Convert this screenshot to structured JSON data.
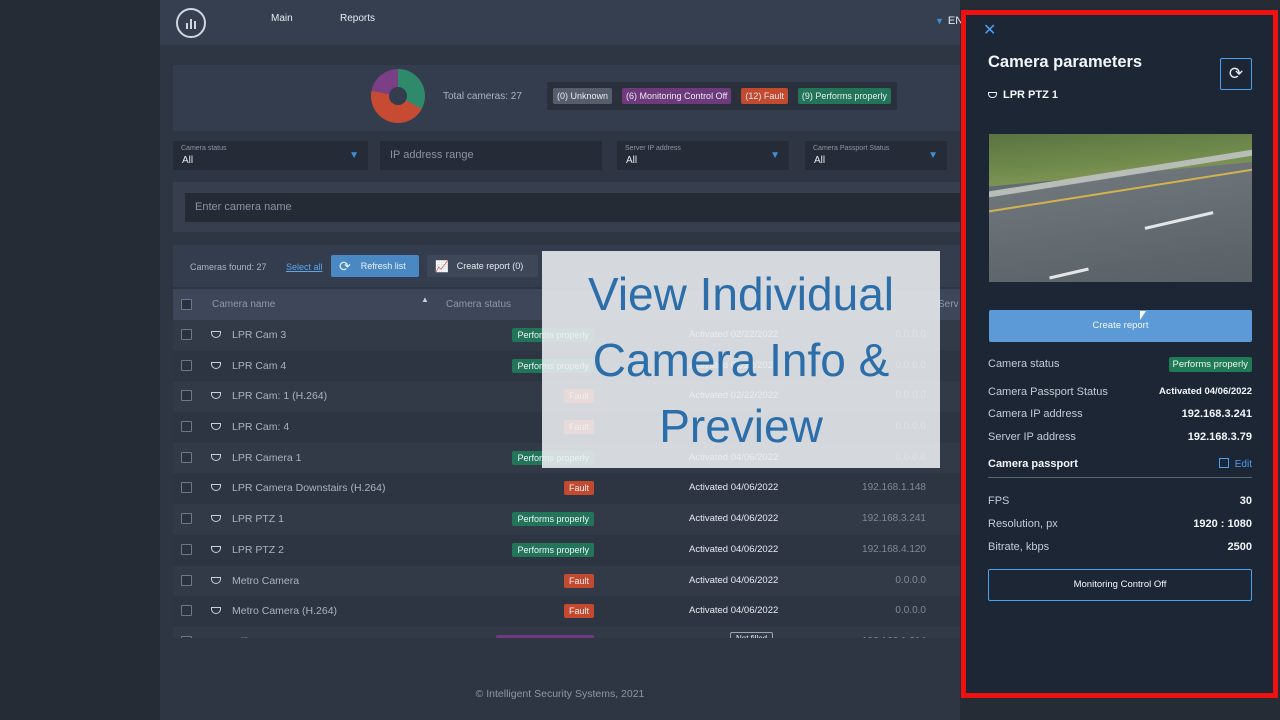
{
  "nav": {
    "main": "Main",
    "reports": "Reports",
    "lang": "EN"
  },
  "summary": {
    "total": "Total cameras: 27",
    "badges": [
      {
        "label": "(0) Unknown",
        "color": "#565e6b"
      },
      {
        "label": "(6) Monitoring Control Off",
        "color": "#6f3a7c"
      },
      {
        "label": "(12) Fault",
        "color": "#c3492f"
      },
      {
        "label": "(9) Performs properly",
        "color": "#23755a"
      }
    ]
  },
  "filters": {
    "status_label": "Camera status",
    "status_value": "All",
    "ip_placeholder": "IP address range",
    "server_label": "Server IP address",
    "server_value": "All",
    "passport_label": "Camera Passport Status",
    "passport_value": "All",
    "name_placeholder": "Enter camera name"
  },
  "toolbar": {
    "found": "Cameras found: 27",
    "select_all": "Select all",
    "refresh": "Refresh list",
    "report": "Create report (0)"
  },
  "table": {
    "headers": {
      "name": "Camera name",
      "status": "Camera status",
      "server": "Serv"
    },
    "rows": [
      {
        "name": "LPR Cam 3",
        "status": "Performs properly",
        "passport": "Activated 02/22/2022",
        "ip": "0.0.0.0"
      },
      {
        "name": "LPR Cam 4",
        "status": "Performs properly",
        "passport": "Activated 02/22/2022",
        "ip": "0.0.0.0"
      },
      {
        "name": "LPR Cam: 1 (H.264)",
        "status": "Fault",
        "passport": "Activated 02/22/2022",
        "ip": "0.0.0.0"
      },
      {
        "name": "LPR Cam: 4",
        "status": "Fault",
        "passport": "",
        "ip": "0.0.0.0"
      },
      {
        "name": "LPR Camera 1",
        "status": "Performs properly",
        "passport": "Activated 04/06/2022",
        "ip": "0.0.0.0"
      },
      {
        "name": "LPR Camera Downstairs (H.264)",
        "status": "Fault",
        "passport": "Activated 04/06/2022",
        "ip": "192.168.1.148"
      },
      {
        "name": "LPR PTZ 1",
        "status": "Performs properly",
        "passport": "Activated 04/06/2022",
        "ip": "192.168.3.241"
      },
      {
        "name": "LPR PTZ 2",
        "status": "Performs properly",
        "passport": "Activated 04/06/2022",
        "ip": "192.168.4.120"
      },
      {
        "name": "Metro Camera",
        "status": "Fault",
        "passport": "Activated 04/06/2022",
        "ip": "0.0.0.0"
      },
      {
        "name": "Metro Camera (H.264)",
        "status": "Fault",
        "passport": "Activated 04/06/2022",
        "ip": "0.0.0.0"
      },
      {
        "name": "Office Entrance",
        "status": "Monitoring Control Off",
        "passport": "Not filled",
        "ip": "192.168.1.214"
      }
    ]
  },
  "status_colors": {
    "Performs properly": "#23755a",
    "Fault": "#c3492f",
    "Monitoring Control Off": "#6f3a7c"
  },
  "footer": "© Intelligent Security Systems, 2021",
  "caption": {
    "line1": "View Individual",
    "line2": "Camera Info &",
    "line3": "Preview"
  },
  "panel": {
    "title": "Camera parameters",
    "camera": "LPR PTZ 1",
    "create_report": "Create report",
    "status_label": "Camera status",
    "status_value": "Performs properly",
    "passport_label": "Camera Passport Status",
    "passport_value": "Activated 04/06/2022",
    "ip_label": "Camera IP address",
    "ip_value": "192.168.3.241",
    "server_label": "Server IP address",
    "server_value": "192.168.3.79",
    "passport_head": "Camera passport",
    "edit": "Edit",
    "fps_label": "FPS",
    "fps_value": "30",
    "res_label": "Resolution, px",
    "res_value": "1920 : 1080",
    "bitrate_label": "Bitrate, kbps",
    "bitrate_value": "2500",
    "monitoring": "Monitoring Control Off"
  }
}
